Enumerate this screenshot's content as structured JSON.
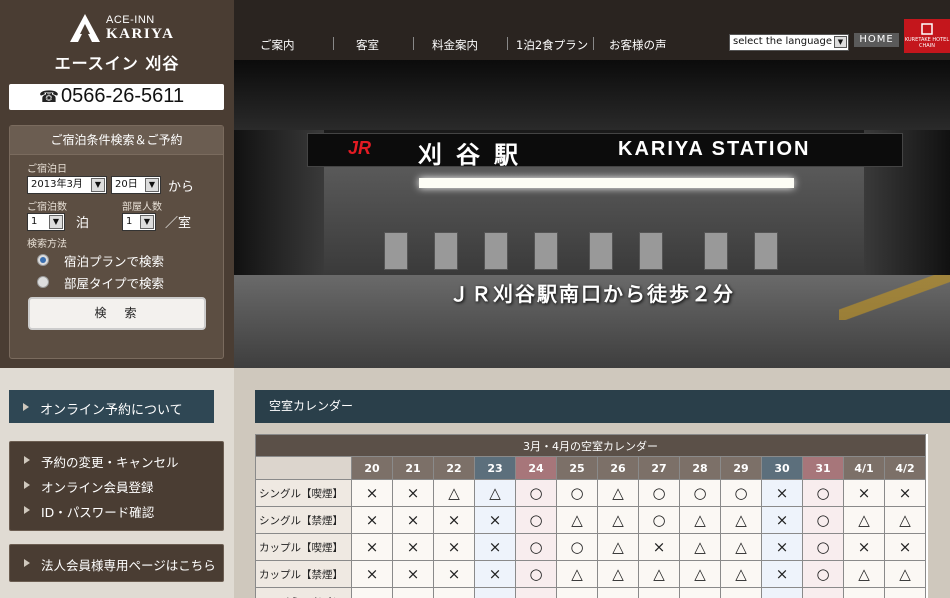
{
  "brand": {
    "en_small": "ACE-INN",
    "en_name": "KARIYA",
    "jp_name": "エースイン 刈谷",
    "tel_icon": "phone-icon",
    "tel": "0566-26-5611"
  },
  "search": {
    "title": "ご宿泊条件検索＆ご予約",
    "date_label": "ご宿泊日",
    "month": "2013年3月",
    "day": "20日",
    "from_text": "から",
    "nights_label": "ご宿泊数",
    "nights": "1",
    "nights_unit": "泊",
    "rooms_label": "部屋人数",
    "rooms": "1",
    "rooms_unit": "／室",
    "method_label": "検索方法",
    "opt_plan": "宿泊プランで検索",
    "opt_room": "部屋タイプで検索",
    "button": "検　索"
  },
  "sidenav": {
    "online": "オンライン予約について",
    "change": "予約の変更・キャンセル",
    "register": "オンライン会員登録",
    "idcheck": "ID・パスワード確認",
    "corporate": "法人会員様専用ページはこちら"
  },
  "topnav": {
    "guide": "ご案内",
    "rooms": "客室",
    "price": "料金案内",
    "plan": "1泊2食プラン",
    "voice": "お客様の声",
    "lang_select": "select the language",
    "home": "HOME",
    "partner": "KURETAKE HOTEL CHAIN"
  },
  "hero": {
    "jr": "JR",
    "station_jp": "刈谷駅",
    "station_en": "KARIYA STATION",
    "caption": "ＪＲ刈谷駅南口から徒歩２分"
  },
  "calendar": {
    "section_title": "空室カレンダー",
    "table_title": "3月・4月の空室カレンダー",
    "dates": [
      "20",
      "21",
      "22",
      "23",
      "24",
      "25",
      "26",
      "27",
      "28",
      "29",
      "30",
      "31",
      "4/1",
      "4/2"
    ],
    "rows": [
      {
        "name": "シングル【喫煙】",
        "cells": [
          "×",
          "×",
          "△",
          "△",
          "○",
          "○",
          "△",
          "○",
          "○",
          "○",
          "×",
          "○",
          "×",
          "×"
        ]
      },
      {
        "name": "シングル【禁煙】",
        "cells": [
          "×",
          "×",
          "×",
          "×",
          "○",
          "△",
          "△",
          "○",
          "△",
          "△",
          "×",
          "○",
          "△",
          "△"
        ]
      },
      {
        "name": "カップル【喫煙】",
        "cells": [
          "×",
          "×",
          "×",
          "×",
          "○",
          "○",
          "△",
          "×",
          "△",
          "△",
          "×",
          "○",
          "×",
          "×"
        ]
      },
      {
        "name": "カップル【禁煙】",
        "cells": [
          "×",
          "×",
          "×",
          "×",
          "○",
          "△",
          "△",
          "△",
          "△",
          "△",
          "×",
          "○",
          "△",
          "△"
        ]
      },
      {
        "name": "エコノミーツイン",
        "cells": [
          "",
          "",
          "",
          "",
          "",
          "",
          "",
          "",
          "",
          "",
          "",
          "",
          "",
          ""
        ]
      }
    ]
  }
}
